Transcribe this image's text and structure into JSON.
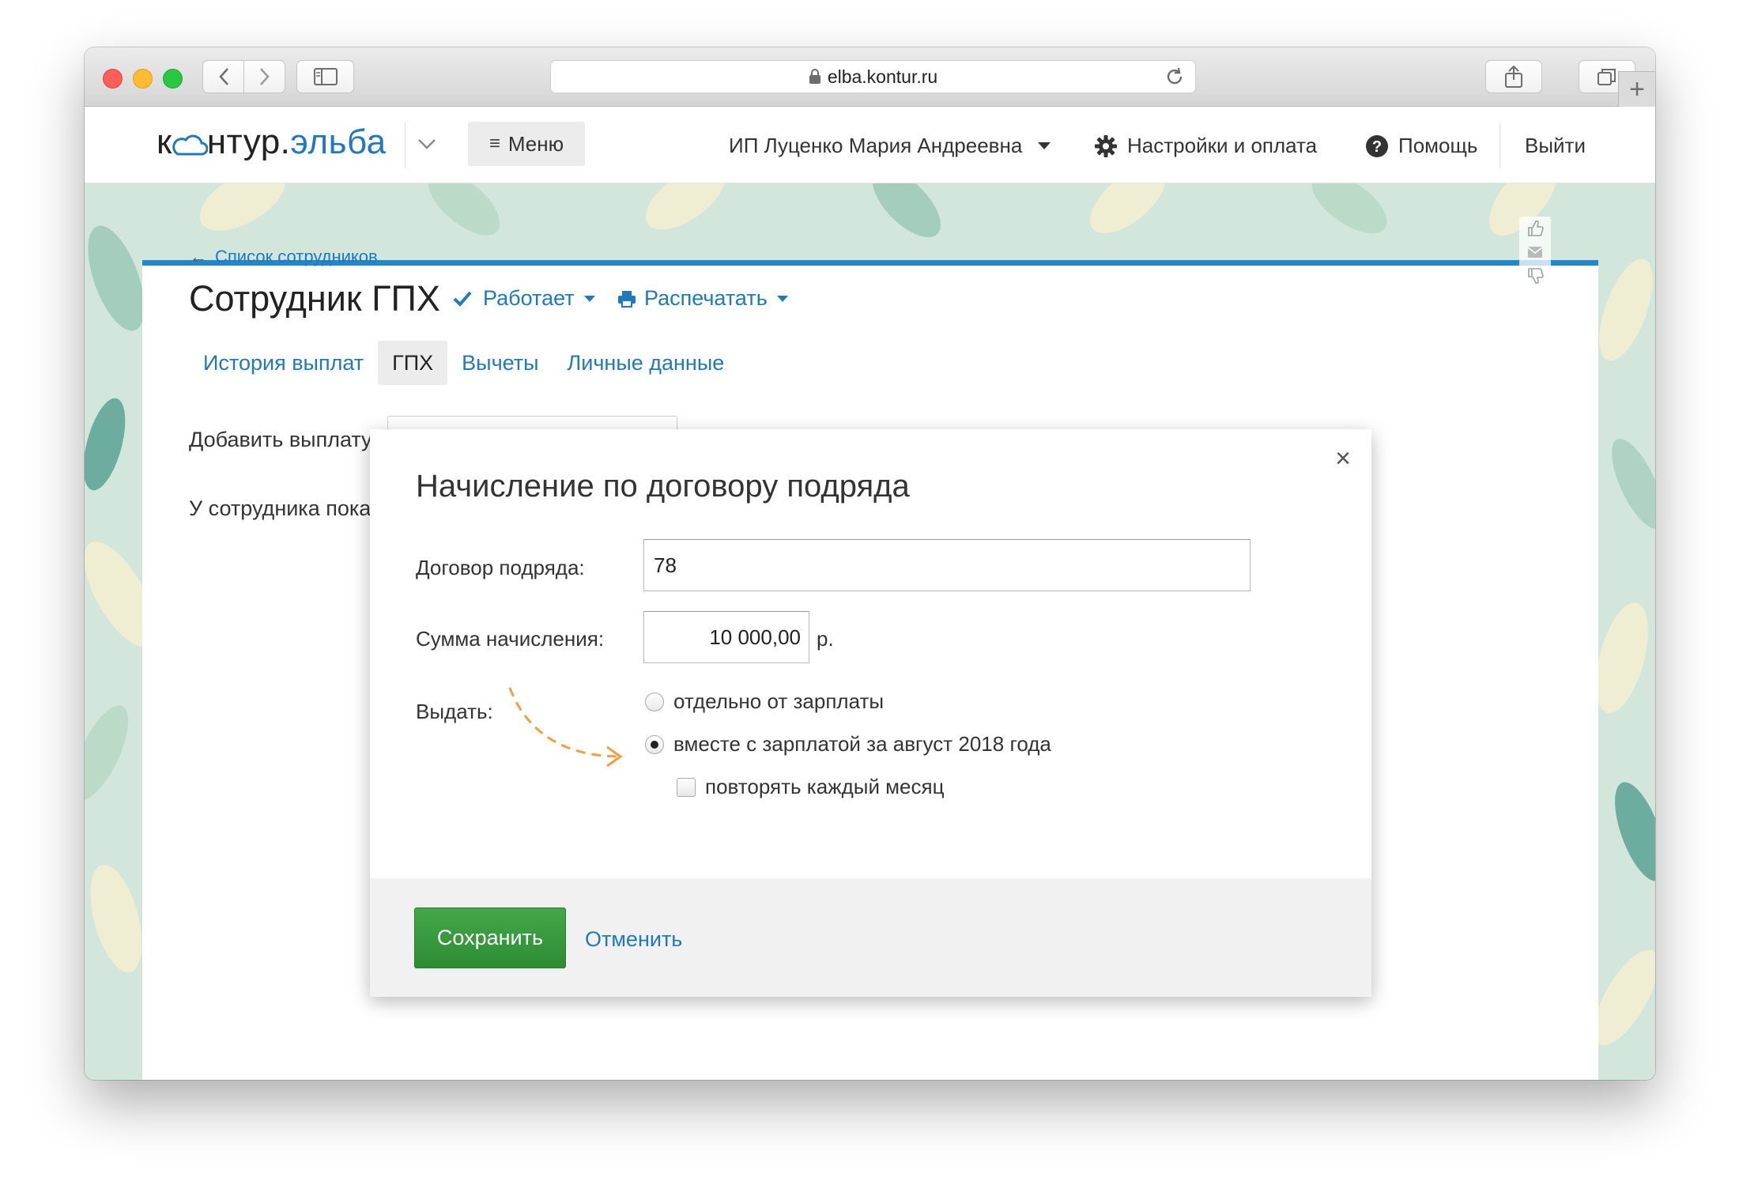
{
  "browser": {
    "url": "elba.kontur.ru"
  },
  "header": {
    "logo_left": "к",
    "logo_mid": "нтур.",
    "logo_right": "эльба",
    "menu_label": "Меню",
    "user_name": "ИП Луценко Мария Андреевна",
    "settings_label": "Настройки и оплата",
    "help_label": "Помощь",
    "logout_label": "Выйти"
  },
  "page": {
    "back_link": "Список сотрудников",
    "back_arrow": "←",
    "title": "Сотрудник ГПХ",
    "status": "Работает",
    "print": "Распечатать",
    "tabs": [
      {
        "label": "История выплат",
        "active": false
      },
      {
        "label": "ГПХ",
        "active": true
      },
      {
        "label": "Вычеты",
        "active": false
      },
      {
        "label": "Личные данные",
        "active": false
      }
    ],
    "add_payment_label": "Добавить выплату:",
    "no_employee_text": "У сотрудника пока"
  },
  "modal": {
    "title": "Начисление по договору подряда",
    "close_symbol": "×",
    "contract_label": "Договор подряда:",
    "contract_value": "78",
    "sum_label": "Сумма начисления:",
    "sum_value": "10 000,00",
    "currency": "р.",
    "issue_label": "Выдать:",
    "options": [
      {
        "label": "отдельно от зарплаты",
        "checked": false
      },
      {
        "label": "вместе с зарплатой за август 2018 года",
        "checked": true
      }
    ],
    "repeat_label": "повторять каждый месяц",
    "repeat_checked": false,
    "save_label": "Сохранить",
    "cancel_label": "Отменить"
  },
  "colors": {
    "accent": "#1e79be",
    "primary_button": "#3a9b40",
    "card_top_border": "#2288cc",
    "annotation_arrow": "#f0a040"
  }
}
